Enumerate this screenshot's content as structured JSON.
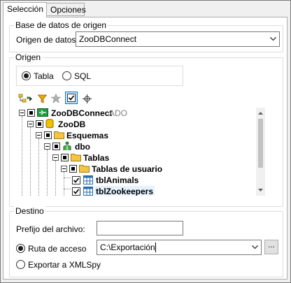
{
  "tabs": [
    {
      "label": "Selección"
    },
    {
      "label": "Opciones"
    }
  ],
  "source_db": {
    "legend": "Base de datos de origen",
    "label": "Origen de datos:",
    "value": "ZooDBConnect"
  },
  "origin": {
    "legend": "Origen",
    "radio_table": "Tabla",
    "radio_sql": "SQL",
    "selected": "Tabla",
    "toolbar": [
      "add-object-icon",
      "filter-icon",
      "star-icon",
      "check-icon",
      "locate-icon"
    ],
    "tree": [
      {
        "label": "ZooDBConnect",
        "suffix": "ADO"
      },
      {
        "label": "ZooDB"
      },
      {
        "label": "Esquemas"
      },
      {
        "label": "dbo"
      },
      {
        "label": "Tablas"
      },
      {
        "label": "Tablas de usuario"
      },
      {
        "label": "tblAnimals",
        "checked": true
      },
      {
        "label": "tblZookeepers",
        "checked": true
      }
    ]
  },
  "destination": {
    "legend": "Destino",
    "prefix_label": "Prefijo del archivo:",
    "prefix_value": "",
    "path_label": "Ruta de acceso",
    "path_value": "C:\\Exportación",
    "browse_label": "...",
    "xmlspy_label": "Exportar a XMLSpy",
    "selected": "Ruta de acceso"
  },
  "colors": {
    "accent": "#0078d7",
    "folder": "#f5c542",
    "db": "#f2c200"
  }
}
